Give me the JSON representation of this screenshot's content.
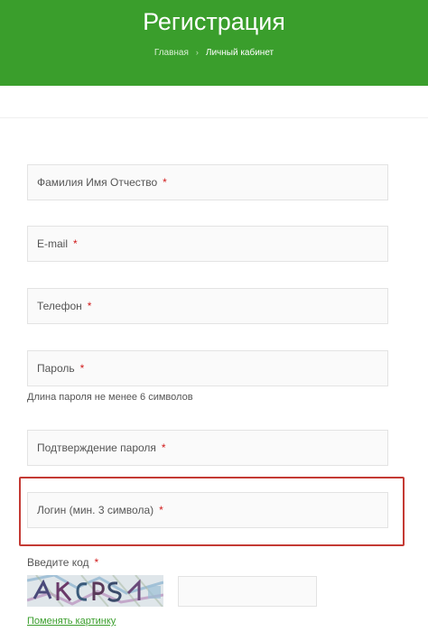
{
  "header": {
    "title": "Регистрация",
    "breadcrumb": {
      "home": "Главная",
      "separator": "›",
      "current": "Личный кабинет"
    },
    "background_color": "#3a9e2c"
  },
  "form": {
    "required_mark": "*",
    "fields": [
      {
        "placeholder": "Фамилия Имя Отчество"
      },
      {
        "placeholder": "E-mail"
      },
      {
        "placeholder": "Телефон"
      },
      {
        "placeholder": "Пароль"
      },
      {
        "placeholder": "Подтверждение пароля"
      },
      {
        "placeholder": "Логин (мин. 3 символа)"
      }
    ],
    "password_hint": "Длина пароля не менее 6 символов",
    "captcha": {
      "label": "Введите код",
      "refresh_link": "Поменять картинку"
    }
  },
  "colors": {
    "accent": "#3a9e2c",
    "required": "#d11a1a",
    "highlight_border": "#c43a34"
  }
}
